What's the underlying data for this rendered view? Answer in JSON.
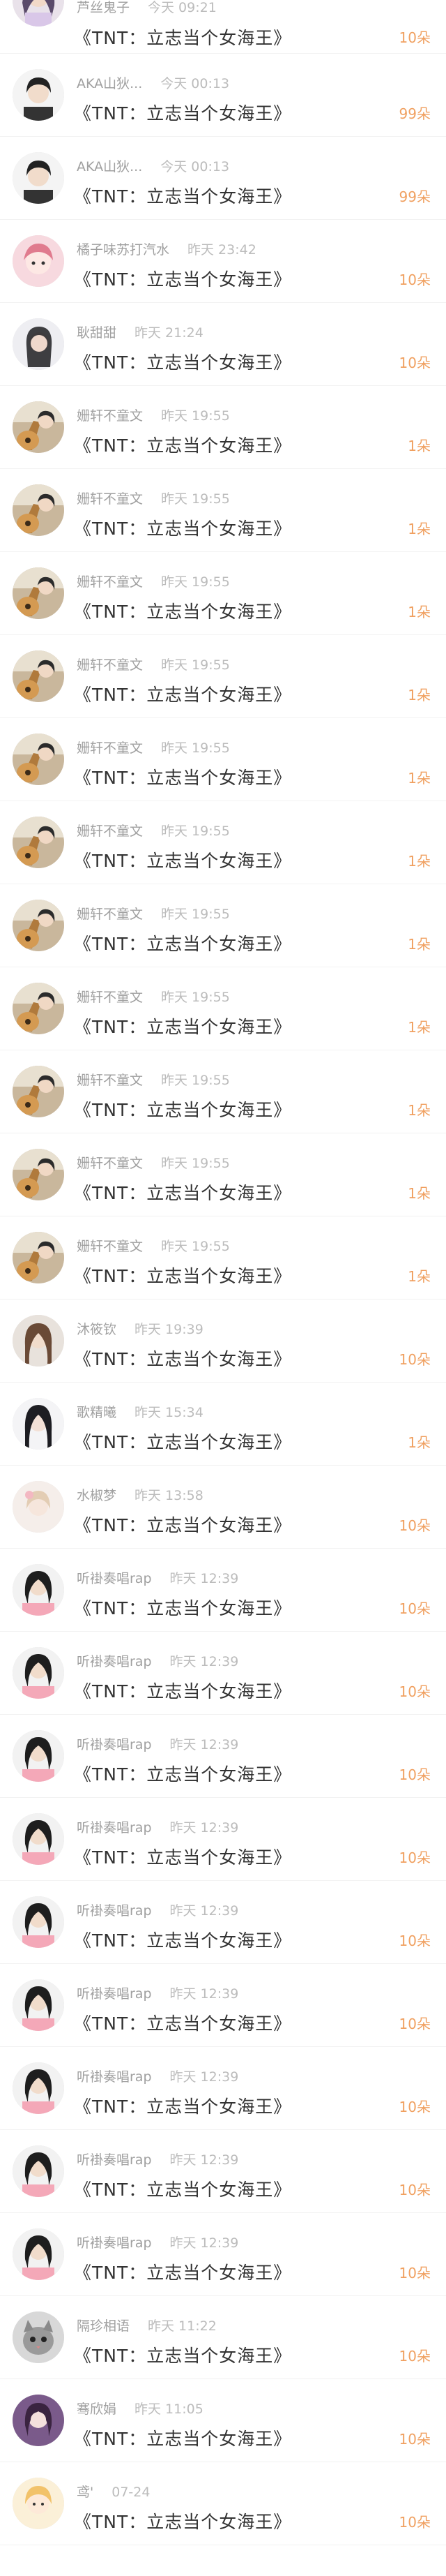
{
  "accent_color": "#f0a060",
  "rows": [
    {
      "name": "芦丝鬼子",
      "time": "今天 09:21",
      "song": "《TNT：立志当个女海王》",
      "count": "10朵",
      "avatar": "pink-hair"
    },
    {
      "name": "AKA山狄...",
      "time": "今天 00:13",
      "song": "《TNT：立志当个女海王》",
      "count": "99朵",
      "avatar": "dark-hair-boy"
    },
    {
      "name": "AKA山狄...",
      "time": "今天 00:13",
      "song": "《TNT：立志当个女海王》",
      "count": "99朵",
      "avatar": "dark-hair-boy"
    },
    {
      "name": "橘子味苏打汽水",
      "time": "昨天 23:42",
      "song": "《TNT：立志当个女海王》",
      "count": "10朵",
      "avatar": "pink-cartoon"
    },
    {
      "name": "耿甜甜",
      "time": "昨天 21:24",
      "song": "《TNT：立志当个女海王》",
      "count": "10朵",
      "avatar": "girl-dark"
    },
    {
      "name": "姗轩不童文",
      "time": "昨天 19:55",
      "song": "《TNT：立志当个女海王》",
      "count": "1朵",
      "avatar": "guitar"
    },
    {
      "name": "姗轩不童文",
      "time": "昨天 19:55",
      "song": "《TNT：立志当个女海王》",
      "count": "1朵",
      "avatar": "guitar"
    },
    {
      "name": "姗轩不童文",
      "time": "昨天 19:55",
      "song": "《TNT：立志当个女海王》",
      "count": "1朵",
      "avatar": "guitar"
    },
    {
      "name": "姗轩不童文",
      "time": "昨天 19:55",
      "song": "《TNT：立志当个女海王》",
      "count": "1朵",
      "avatar": "guitar"
    },
    {
      "name": "姗轩不童文",
      "time": "昨天 19:55",
      "song": "《TNT：立志当个女海王》",
      "count": "1朵",
      "avatar": "guitar"
    },
    {
      "name": "姗轩不童文",
      "time": "昨天 19:55",
      "song": "《TNT：立志当个女海王》",
      "count": "1朵",
      "avatar": "guitar"
    },
    {
      "name": "姗轩不童文",
      "time": "昨天 19:55",
      "song": "《TNT：立志当个女海王》",
      "count": "1朵",
      "avatar": "guitar"
    },
    {
      "name": "姗轩不童文",
      "time": "昨天 19:55",
      "song": "《TNT：立志当个女海王》",
      "count": "1朵",
      "avatar": "guitar"
    },
    {
      "name": "姗轩不童文",
      "time": "昨天 19:55",
      "song": "《TNT：立志当个女海王》",
      "count": "1朵",
      "avatar": "guitar"
    },
    {
      "name": "姗轩不童文",
      "time": "昨天 19:55",
      "song": "《TNT：立志当个女海王》",
      "count": "1朵",
      "avatar": "guitar"
    },
    {
      "name": "姗轩不童文",
      "time": "昨天 19:55",
      "song": "《TNT：立志当个女海王》",
      "count": "1朵",
      "avatar": "guitar"
    },
    {
      "name": "沐筱钦",
      "time": "昨天 19:39",
      "song": "《TNT：立志当个女海王》",
      "count": "10朵",
      "avatar": "girl-brown"
    },
    {
      "name": "歌精曦",
      "time": "昨天 15:34",
      "song": "《TNT：立志当个女海王》",
      "count": "1朵",
      "avatar": "girl-black"
    },
    {
      "name": "水椒梦",
      "time": "昨天 13:58",
      "song": "《TNT：立志当个女海王》",
      "count": "10朵",
      "avatar": "light-girl"
    },
    {
      "name": "听褂奏唱rap",
      "time": "昨天 12:39",
      "song": "《TNT：立志当个女海王》",
      "count": "10朵",
      "avatar": "girl-pink-top"
    },
    {
      "name": "听褂奏唱rap",
      "time": "昨天 12:39",
      "song": "《TNT：立志当个女海王》",
      "count": "10朵",
      "avatar": "girl-pink-top"
    },
    {
      "name": "听褂奏唱rap",
      "time": "昨天 12:39",
      "song": "《TNT：立志当个女海王》",
      "count": "10朵",
      "avatar": "girl-pink-top"
    },
    {
      "name": "听褂奏唱rap",
      "time": "昨天 12:39",
      "song": "《TNT：立志当个女海王》",
      "count": "10朵",
      "avatar": "girl-pink-top"
    },
    {
      "name": "听褂奏唱rap",
      "time": "昨天 12:39",
      "song": "《TNT：立志当个女海王》",
      "count": "10朵",
      "avatar": "girl-pink-top"
    },
    {
      "name": "听褂奏唱rap",
      "time": "昨天 12:39",
      "song": "《TNT：立志当个女海王》",
      "count": "10朵",
      "avatar": "girl-pink-top"
    },
    {
      "name": "听褂奏唱rap",
      "time": "昨天 12:39",
      "song": "《TNT：立志当个女海王》",
      "count": "10朵",
      "avatar": "girl-pink-top"
    },
    {
      "name": "听褂奏唱rap",
      "time": "昨天 12:39",
      "song": "《TNT：立志当个女海王》",
      "count": "10朵",
      "avatar": "girl-pink-top"
    },
    {
      "name": "听褂奏唱rap",
      "time": "昨天 12:39",
      "song": "《TNT：立志当个女海王》",
      "count": "10朵",
      "avatar": "girl-pink-top"
    },
    {
      "name": "隔珍相语",
      "time": "昨天 11:22",
      "song": "《TNT：立志当个女海王》",
      "count": "10朵",
      "avatar": "cat"
    },
    {
      "name": "骞欣娟",
      "time": "昨天 11:05",
      "song": "《TNT：立志当个女海王》",
      "count": "10朵",
      "avatar": "purple-girl"
    },
    {
      "name": "鸢'",
      "time": "07-24",
      "song": "《TNT：立志当个女海王》",
      "count": "10朵",
      "avatar": "yellow-girl"
    }
  ]
}
